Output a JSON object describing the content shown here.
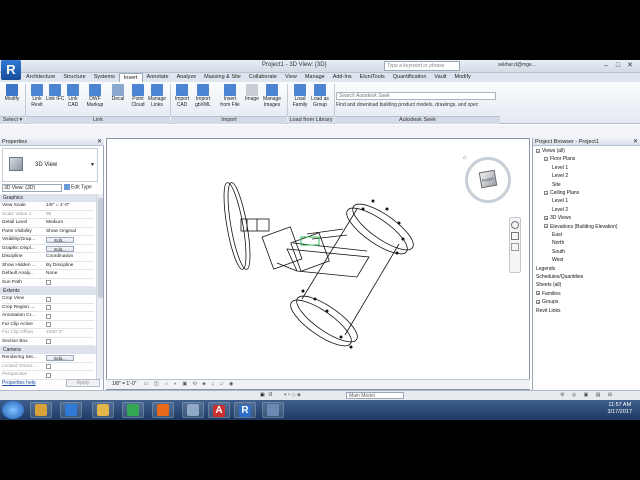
{
  "window": {
    "title": "Project1 - 3D View: {3D}",
    "search_placeholder": "Type a keyword or phrase",
    "user": "sekhar.d@mge..."
  },
  "tabs": [
    "Architecture",
    "Structure",
    "Systems",
    "Insert",
    "Annotate",
    "Analyze",
    "Massing & Site",
    "Collaborate",
    "View",
    "Manage",
    "Add-Ins",
    "EluniTools",
    "Quantification",
    "Vault",
    "Modify"
  ],
  "active_tab": "Insert",
  "ribbon": {
    "buttons": [
      {
        "label": "Modify",
        "color": "#3b76c8"
      },
      {
        "label": "Link Revit",
        "color": "#4a84d2"
      },
      {
        "label": "Link IFC",
        "color": "#4a84d2"
      },
      {
        "label": "Link CAD",
        "color": "#4a84d2"
      },
      {
        "label": "DWF Markup",
        "color": "#4a84d2"
      },
      {
        "label": "Decal",
        "color": "#8aa8cf"
      },
      {
        "label": "Point Cloud",
        "color": "#4a84d2"
      },
      {
        "label": "Manage Links",
        "color": "#4a84d2"
      },
      {
        "label": "Import CAD",
        "color": "#4a84d2"
      },
      {
        "label": "Import gbXML",
        "color": "#4a84d2"
      },
      {
        "label": "Insert from File",
        "color": "#4a84d2"
      },
      {
        "label": "Image",
        "color": "#c9ced6"
      },
      {
        "label": "Manage Images",
        "color": "#4a84d2"
      },
      {
        "label": "Load Family",
        "color": "#4a84d2"
      },
      {
        "label": "Load as Group",
        "color": "#4a84d2"
      }
    ],
    "groups": [
      "Select ▾",
      "Link",
      "Import",
      "Load from Library",
      "Autodesk Seek"
    ],
    "seek_placeholder": "Search Autodesk Seek",
    "seek_description": "Find and download building product models, drawings, and spec"
  },
  "properties": {
    "title": "Properties",
    "type_name": "3D View",
    "selector": "3D View: {3D}",
    "edit_type": "Edit Type",
    "sections": {
      "graphics": "Graphics",
      "extents": "Extents",
      "camera": "Camera"
    },
    "rows": [
      {
        "k": "View Scale",
        "v": "1/8\" = 1'-0\""
      },
      {
        "k": "Scale Value  1:",
        "v": "96"
      },
      {
        "k": "Detail Level",
        "v": "Medium"
      },
      {
        "k": "Parts Visibility",
        "v": "Show Original"
      },
      {
        "k": "Visibility/Grap...",
        "v": "Edit..."
      },
      {
        "k": "Graphic Displ...",
        "v": "Edit..."
      },
      {
        "k": "Discipline",
        "v": "Coordination"
      },
      {
        "k": "Show Hidden ...",
        "v": "By Discipline"
      },
      {
        "k": "Default Analy...",
        "v": "None"
      },
      {
        "k": "Sun Path",
        "v": ""
      }
    ],
    "extents_rows": [
      {
        "k": "Crop View",
        "v": ""
      },
      {
        "k": "Crop Region ...",
        "v": ""
      },
      {
        "k": "Annotation Cr...",
        "v": ""
      },
      {
        "k": "Far Clip Active",
        "v": ""
      },
      {
        "k": "Far Clip Offset",
        "v": "1000' 0\""
      },
      {
        "k": "Section Box",
        "v": ""
      }
    ],
    "camera_rows": [
      {
        "k": "Rendering Set...",
        "v": "Edit..."
      },
      {
        "k": "Locked Orient...",
        "v": ""
      },
      {
        "k": "Perspective",
        "v": ""
      }
    ],
    "help": "Properties help",
    "apply": "Apply"
  },
  "view": {
    "scale_label": "1/8\" = 1'-0\"",
    "viewcube_face": "FRONT"
  },
  "browser": {
    "title": "Project Browser - Project1",
    "items": [
      {
        "label": "Views (all)",
        "level": 0,
        "toggle": "−"
      },
      {
        "label": "Floor Plans",
        "level": 1,
        "toggle": "−"
      },
      {
        "label": "Level 1",
        "level": 2
      },
      {
        "label": "Level 2",
        "level": 2
      },
      {
        "label": "Site",
        "level": 2
      },
      {
        "label": "Ceiling Plans",
        "level": 1,
        "toggle": "−"
      },
      {
        "label": "Level 1",
        "level": 2
      },
      {
        "label": "Level 2",
        "level": 2
      },
      {
        "label": "3D Views",
        "level": 1,
        "toggle": "+"
      },
      {
        "label": "Elevations (Building Elevation)",
        "level": 1,
        "toggle": "−"
      },
      {
        "label": "East",
        "level": 2
      },
      {
        "label": "North",
        "level": 2
      },
      {
        "label": "South",
        "level": 2
      },
      {
        "label": "West",
        "level": 2
      },
      {
        "label": "Legends",
        "level": 0
      },
      {
        "label": "Schedules/Quantities",
        "level": 0
      },
      {
        "label": "Sheets (all)",
        "level": 0
      },
      {
        "label": "Families",
        "level": 0,
        "toggle": "+"
      },
      {
        "label": "Groups",
        "level": 0,
        "toggle": "+"
      },
      {
        "label": "Revit Links",
        "level": 0
      }
    ]
  },
  "statusbar": {
    "zero": ":0",
    "model": "Main Model"
  },
  "taskbar": {
    "apps": [
      "",
      "",
      "",
      "",
      "",
      "",
      "A",
      "R",
      ""
    ],
    "time": "11:57 AM",
    "date": "3/17/2017"
  }
}
